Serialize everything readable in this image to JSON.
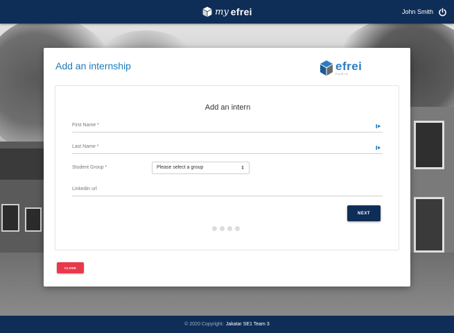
{
  "header": {
    "brand_my": "my",
    "brand_efrei": "efrei",
    "user_name": "John Smith"
  },
  "card": {
    "title": "Add an internship",
    "logo_word": "efrei",
    "logo_sub": "PARIS"
  },
  "form": {
    "title": "Add an intern",
    "first_name_label": "First Name *",
    "last_name_label": "Last Name *",
    "group_label": "Student Group *",
    "group_selected": "Please select a group",
    "linkedin_label": "Linkedin url",
    "next_label": "NEXT",
    "steps": 4
  },
  "actions": {
    "close_label": "CLOSE"
  },
  "footer": {
    "copyright": "© 2020 Copyright:",
    "team": "Jakatar SE1 Team 3"
  },
  "colors": {
    "navy": "#0f2e57",
    "title_blue": "#1d7ab8",
    "close_red": "#e8394b"
  }
}
